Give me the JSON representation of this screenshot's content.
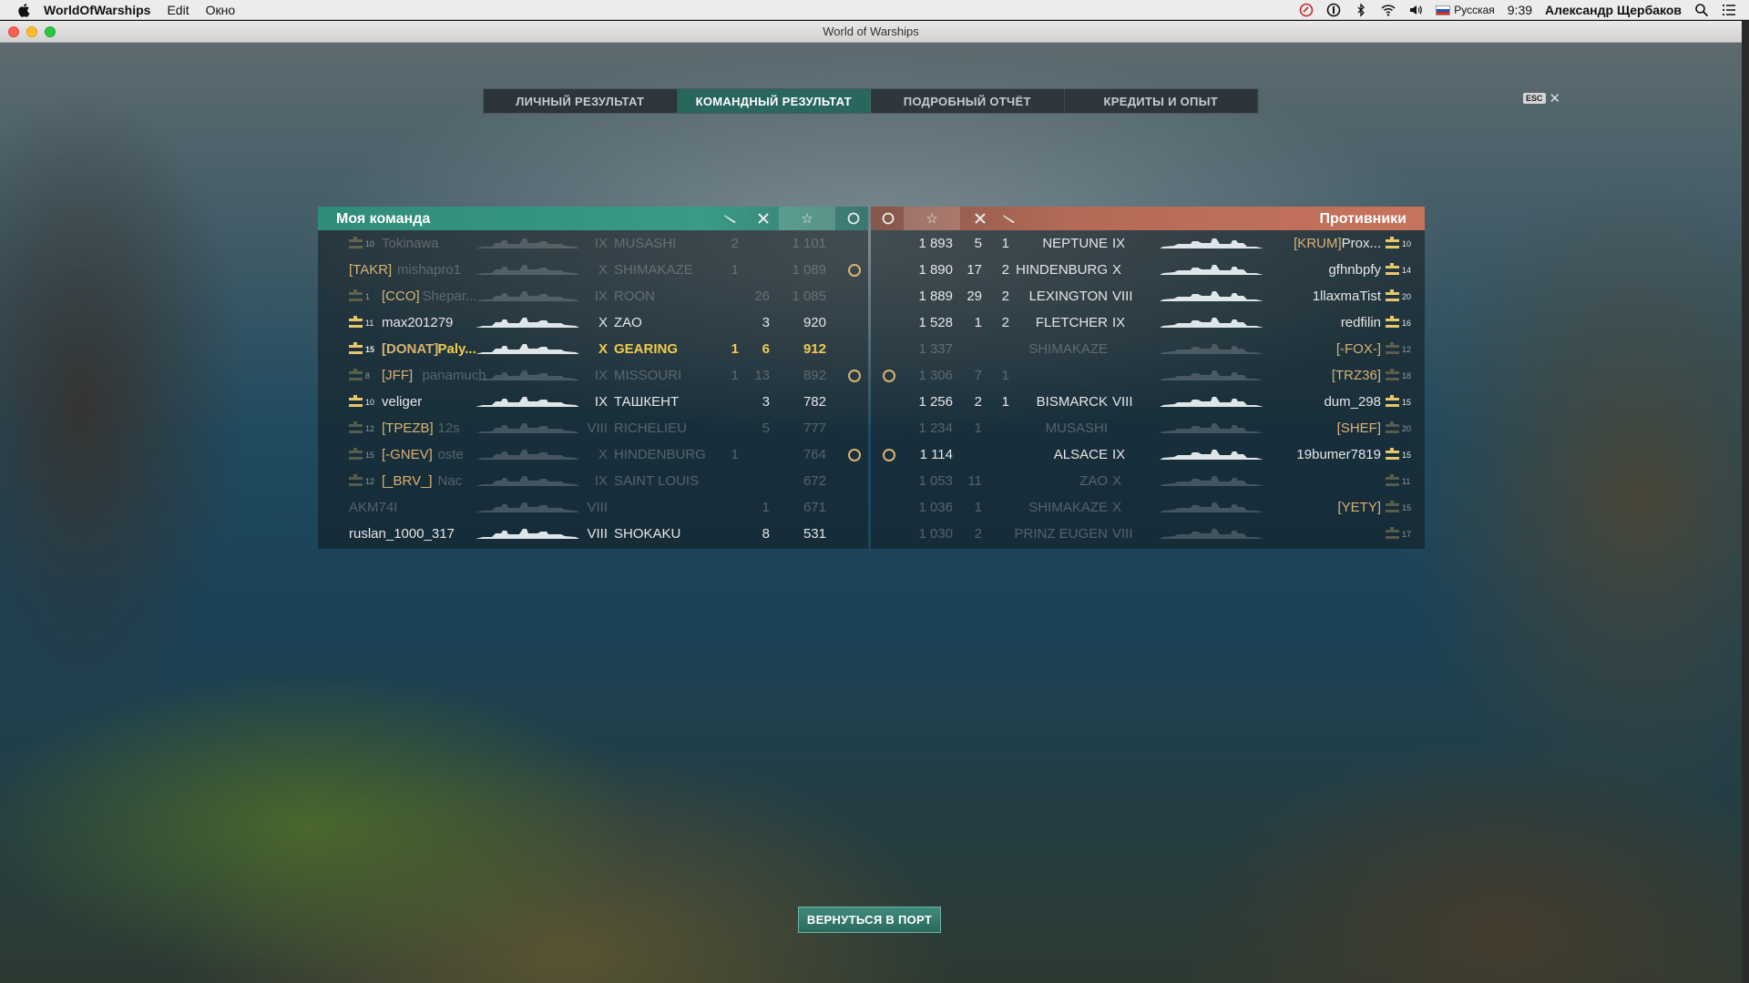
{
  "menubar": {
    "app_name": "WorldOfWarships",
    "menus": [
      "Edit",
      "Окно"
    ],
    "input_source": "Русская",
    "time": "9:39",
    "user": "Александр Щербаков"
  },
  "window": {
    "title": "World of Warships"
  },
  "tabs": [
    "ЛИЧНЫЙ РЕЗУЛЬТАТ",
    "КОМАНДНЫЙ РЕЗУЛЬТАТ",
    "ПОДРОБНЫЙ ОТЧЁТ",
    "КРЕДИТЫ И ОПЫТ"
  ],
  "active_tab": 1,
  "esc": {
    "key": "ESC"
  },
  "my_team": {
    "title": "Моя команда",
    "color": "#3a9b86",
    "rows": [
      {
        "rank": "10",
        "clan": "",
        "name": "Tokinawa",
        "tier": "IX",
        "ship": "MUSASHI",
        "planes": "2",
        "frags": "",
        "xp": "1 101",
        "medal": false,
        "dim": true
      },
      {
        "rank": "",
        "clan": "[TAKR]",
        "name": "mishapro1",
        "tier": "X",
        "ship": "SHIMAKAZE",
        "planes": "1",
        "frags": "",
        "xp": "1 089",
        "medal": true,
        "dim": true
      },
      {
        "rank": "1",
        "clan": "[CCO]",
        "name": "Shepar...",
        "tier": "IX",
        "ship": "ROON",
        "planes": "",
        "frags": "26",
        "xp": "1 085",
        "medal": false,
        "dim": true
      },
      {
        "rank": "11",
        "clan": "",
        "name": "max201279",
        "tier": "X",
        "ship": "ZAO",
        "planes": "",
        "frags": "3",
        "xp": "920",
        "medal": false,
        "dim": false
      },
      {
        "rank": "15",
        "clan": "[DONAT]",
        "name": "Paly...",
        "tier": "X",
        "ship": "GEARING",
        "planes": "1",
        "frags": "6",
        "xp": "912",
        "medal": false,
        "dim": false,
        "highlight": true
      },
      {
        "rank": "8",
        "clan": "[JFF]",
        "name": "panamuch",
        "tier": "IX",
        "ship": "MISSOURI",
        "planes": "1",
        "frags": "13",
        "xp": "892",
        "medal": true,
        "dim": true
      },
      {
        "rank": "10",
        "clan": "",
        "name": "veliger",
        "tier": "IX",
        "ship": "ТАШКЕНТ",
        "planes": "",
        "frags": "3",
        "xp": "782",
        "medal": false,
        "dim": false
      },
      {
        "rank": "12",
        "clan": "[TPEZB]",
        "name": "12s",
        "tier": "VIII",
        "ship": "RICHELIEU",
        "planes": "",
        "frags": "5",
        "xp": "777",
        "medal": false,
        "dim": true
      },
      {
        "rank": "15",
        "clan": "[-GNEV]",
        "name": "oste",
        "tier": "X",
        "ship": "HINDENBURG",
        "planes": "1",
        "frags": "",
        "xp": "764",
        "medal": true,
        "dim": true
      },
      {
        "rank": "12",
        "clan": "[_BRV_]",
        "name": "Nac",
        "tier": "IX",
        "ship": "SAINT LOUIS",
        "planes": "",
        "frags": "",
        "xp": "672",
        "medal": false,
        "dim": true
      },
      {
        "rank": "",
        "clan": "",
        "name": "AKM74I",
        "tier": "VIII",
        "ship": "",
        "planes": "",
        "frags": "1",
        "xp": "671",
        "medal": false,
        "dim": true
      },
      {
        "rank": "",
        "clan": "",
        "name": "ruslan_1000_317",
        "tier": "VIII",
        "ship": "SHOKAKU",
        "planes": "",
        "frags": "8",
        "xp": "531",
        "medal": false,
        "dim": false
      }
    ]
  },
  "enemy_team": {
    "title": "Противники",
    "color": "#c7735c",
    "rows": [
      {
        "medal": false,
        "xp": "1 893",
        "frags": "5",
        "planes": "1",
        "ship": "NEPTUNE",
        "tier": "IX",
        "clan": "[KRUM]",
        "name": "Prox...",
        "rank": "10",
        "dim": false
      },
      {
        "medal": false,
        "xp": "1 890",
        "frags": "17",
        "planes": "2",
        "ship": "HINDENBURG",
        "tier": "X",
        "clan": "",
        "name": "gfhnbpfy",
        "rank": "14",
        "dim": false
      },
      {
        "medal": false,
        "xp": "1 889",
        "frags": "29",
        "planes": "2",
        "ship": "LEXINGTON",
        "tier": "VIII",
        "clan": "",
        "name": "1llaxmaTist",
        "rank": "20",
        "dim": false
      },
      {
        "medal": false,
        "xp": "1 528",
        "frags": "1",
        "planes": "2",
        "ship": "FLETCHER",
        "tier": "IX",
        "clan": "",
        "name": "redfilin",
        "rank": "16",
        "dim": false
      },
      {
        "medal": false,
        "xp": "1 337",
        "frags": "",
        "planes": "",
        "ship": "SHIMAKAZE",
        "tier": "",
        "clan": "[-FOX-]",
        "name": "",
        "rank": "12",
        "dim": true
      },
      {
        "medal": true,
        "xp": "1 306",
        "frags": "7",
        "planes": "1",
        "ship": "",
        "tier": "",
        "clan": "[TRZ36]",
        "name": "",
        "rank": "18",
        "dim": true
      },
      {
        "medal": false,
        "xp": "1 256",
        "frags": "2",
        "planes": "1",
        "ship": "BISMARCK",
        "tier": "VIII",
        "clan": "",
        "name": "dum_298",
        "rank": "15",
        "dim": false
      },
      {
        "medal": false,
        "xp": "1 234",
        "frags": "1",
        "planes": "",
        "ship": "MUSASHI",
        "tier": "",
        "clan": "[SHEF]",
        "name": "",
        "rank": "20",
        "dim": true
      },
      {
        "medal": true,
        "xp": "1 114",
        "frags": "",
        "planes": "",
        "ship": "ALSACE",
        "tier": "IX",
        "clan": "",
        "name": "19bumer7819",
        "rank": "15",
        "dim": false
      },
      {
        "medal": false,
        "xp": "1 053",
        "frags": "11",
        "planes": "",
        "ship": "ZAO",
        "tier": "X",
        "clan": "",
        "name": "",
        "rank": "11",
        "dim": true
      },
      {
        "medal": false,
        "xp": "1 036",
        "frags": "1",
        "planes": "",
        "ship": "SHIMAKAZE",
        "tier": "X",
        "clan": "[YETY]",
        "name": "",
        "rank": "15",
        "dim": true
      },
      {
        "medal": false,
        "xp": "1 030",
        "frags": "2",
        "planes": "",
        "ship": "PRINZ EUGEN",
        "tier": "VIII",
        "clan": "",
        "name": "",
        "rank": "17",
        "dim": true
      }
    ]
  },
  "back_button": "ВЕРНУТЬСЯ В ПОРТ"
}
